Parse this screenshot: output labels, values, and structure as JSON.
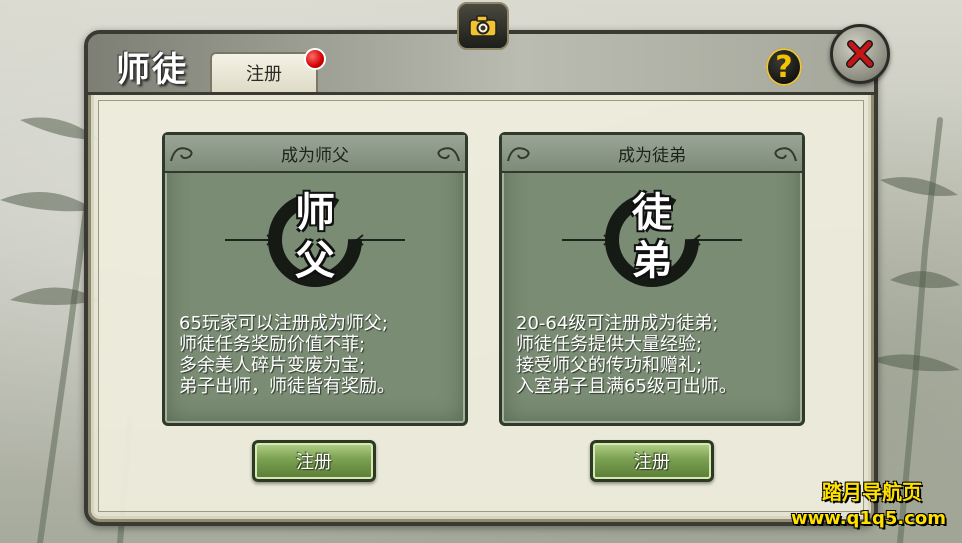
{
  "header": {
    "title": "师徒",
    "tab_label": "注册",
    "help_symbol": "?"
  },
  "cards": [
    {
      "heading": "成为师父",
      "emblem_chars": [
        "师",
        "父"
      ],
      "description": [
        "65玩家可以注册成为师父;",
        "师徒任务奖励价值不菲;",
        "多余美人碎片变废为宝;",
        "弟子出师，师徒皆有奖励。"
      ],
      "button_label": "注册"
    },
    {
      "heading": "成为徒弟",
      "emblem_chars": [
        "徒",
        "弟"
      ],
      "description": [
        "20-64级可注册成为徒弟;",
        "师徒任务提供大量经验;",
        "接受师父的传功和赠礼;",
        "入室弟子且满65级可出师。"
      ],
      "button_label": "注册"
    }
  ],
  "watermark": {
    "line1": "踏月导航页",
    "line2": "www.q1q5.com"
  },
  "icons": {
    "camera": "camera-icon",
    "close": "close-icon",
    "help": "help-icon"
  },
  "colors": {
    "card_bg": "#7a8c74",
    "button_green": "#7aa050",
    "notification_red": "#d40000",
    "watermark_yellow": "#ffe100"
  }
}
